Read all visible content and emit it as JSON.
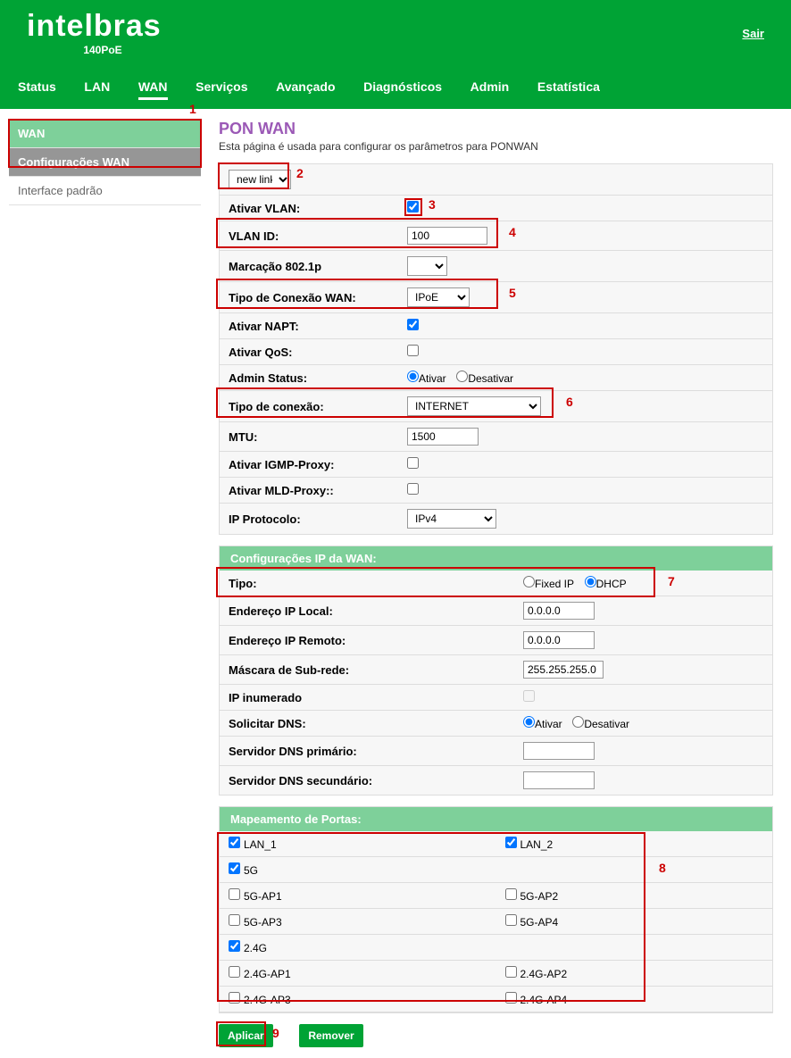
{
  "header": {
    "brand": "intelbras",
    "model": "140PoE",
    "logout": "Sair"
  },
  "nav": {
    "items": [
      "Status",
      "LAN",
      "WAN",
      "Serviços",
      "Avançado",
      "Diagnósticos",
      "Admin",
      "Estatística"
    ],
    "active": "WAN"
  },
  "sidebar": {
    "group": "WAN",
    "items": [
      {
        "label": "Configurações WAN",
        "active": true
      },
      {
        "label": "Interface padrão",
        "active": false
      }
    ]
  },
  "page": {
    "title": "PON WAN",
    "desc": "Esta página é usada para configurar os parâmetros para PONWAN"
  },
  "form": {
    "link_select": "new link",
    "ativar_vlan_label": "Ativar VLAN:",
    "ativar_vlan_checked": true,
    "vlan_id_label": "VLAN ID:",
    "vlan_id_value": "100",
    "marcacao_label": "Marcação 802.1p",
    "marcacao_value": "",
    "tipo_wan_label": "Tipo de Conexão WAN:",
    "tipo_wan_value": "IPoE",
    "ativar_napt_label": "Ativar NAPT:",
    "ativar_napt_checked": true,
    "ativar_qos_label": "Ativar QoS:",
    "ativar_qos_checked": false,
    "admin_status_label": "Admin Status:",
    "admin_ativar": "Ativar",
    "admin_desativar": "Desativar",
    "tipo_conexao_label": "Tipo de conexão:",
    "tipo_conexao_value": "INTERNET",
    "mtu_label": "MTU:",
    "mtu_value": "1500",
    "igmp_label": "Ativar IGMP-Proxy:",
    "igmp_checked": false,
    "mld_label": "Ativar MLD-Proxy::",
    "mld_checked": false,
    "ip_proto_label": "IP Protocolo:",
    "ip_proto_value": "IPv4"
  },
  "ipwan": {
    "header": "Configurações IP da WAN:",
    "tipo_label": "Tipo:",
    "fixed_ip": "Fixed IP",
    "dhcp": "DHCP",
    "local_label": "Endereço IP Local:",
    "local_value": "0.0.0.0",
    "remoto_label": "Endereço IP Remoto:",
    "remoto_value": "0.0.0.0",
    "mask_label": "Máscara de Sub-rede:",
    "mask_value": "255.255.255.0",
    "inumerado_label": "IP inumerado",
    "inumerado_checked": false,
    "dns_req_label": "Solicitar DNS:",
    "dns_ativar": "Ativar",
    "dns_desativar": "Desativar",
    "dns1_label": "Servidor DNS primário:",
    "dns1_value": "",
    "dns2_label": "Servidor DNS secundário:",
    "dns2_value": ""
  },
  "ports": {
    "header": "Mapeamento de Portas:",
    "rows": [
      [
        {
          "label": "LAN_1",
          "checked": true
        },
        {
          "label": "LAN_2",
          "checked": true
        }
      ],
      [
        {
          "label": "5G",
          "checked": true
        },
        null
      ],
      [
        {
          "label": "5G-AP1",
          "checked": false
        },
        {
          "label": "5G-AP2",
          "checked": false
        }
      ],
      [
        {
          "label": "5G-AP3",
          "checked": false
        },
        {
          "label": "5G-AP4",
          "checked": false
        }
      ],
      [
        {
          "label": "2.4G",
          "checked": true
        },
        null
      ],
      [
        {
          "label": "2.4G-AP1",
          "checked": false
        },
        {
          "label": "2.4G-AP2",
          "checked": false
        }
      ],
      [
        {
          "label": "2.4G-AP3",
          "checked": false
        },
        {
          "label": "2.4G-AP4",
          "checked": false
        }
      ]
    ]
  },
  "buttons": {
    "apply": "Aplicar",
    "remove": "Remover"
  },
  "annotations": [
    "1",
    "2",
    "3",
    "4",
    "5",
    "6",
    "7",
    "8",
    "9"
  ]
}
